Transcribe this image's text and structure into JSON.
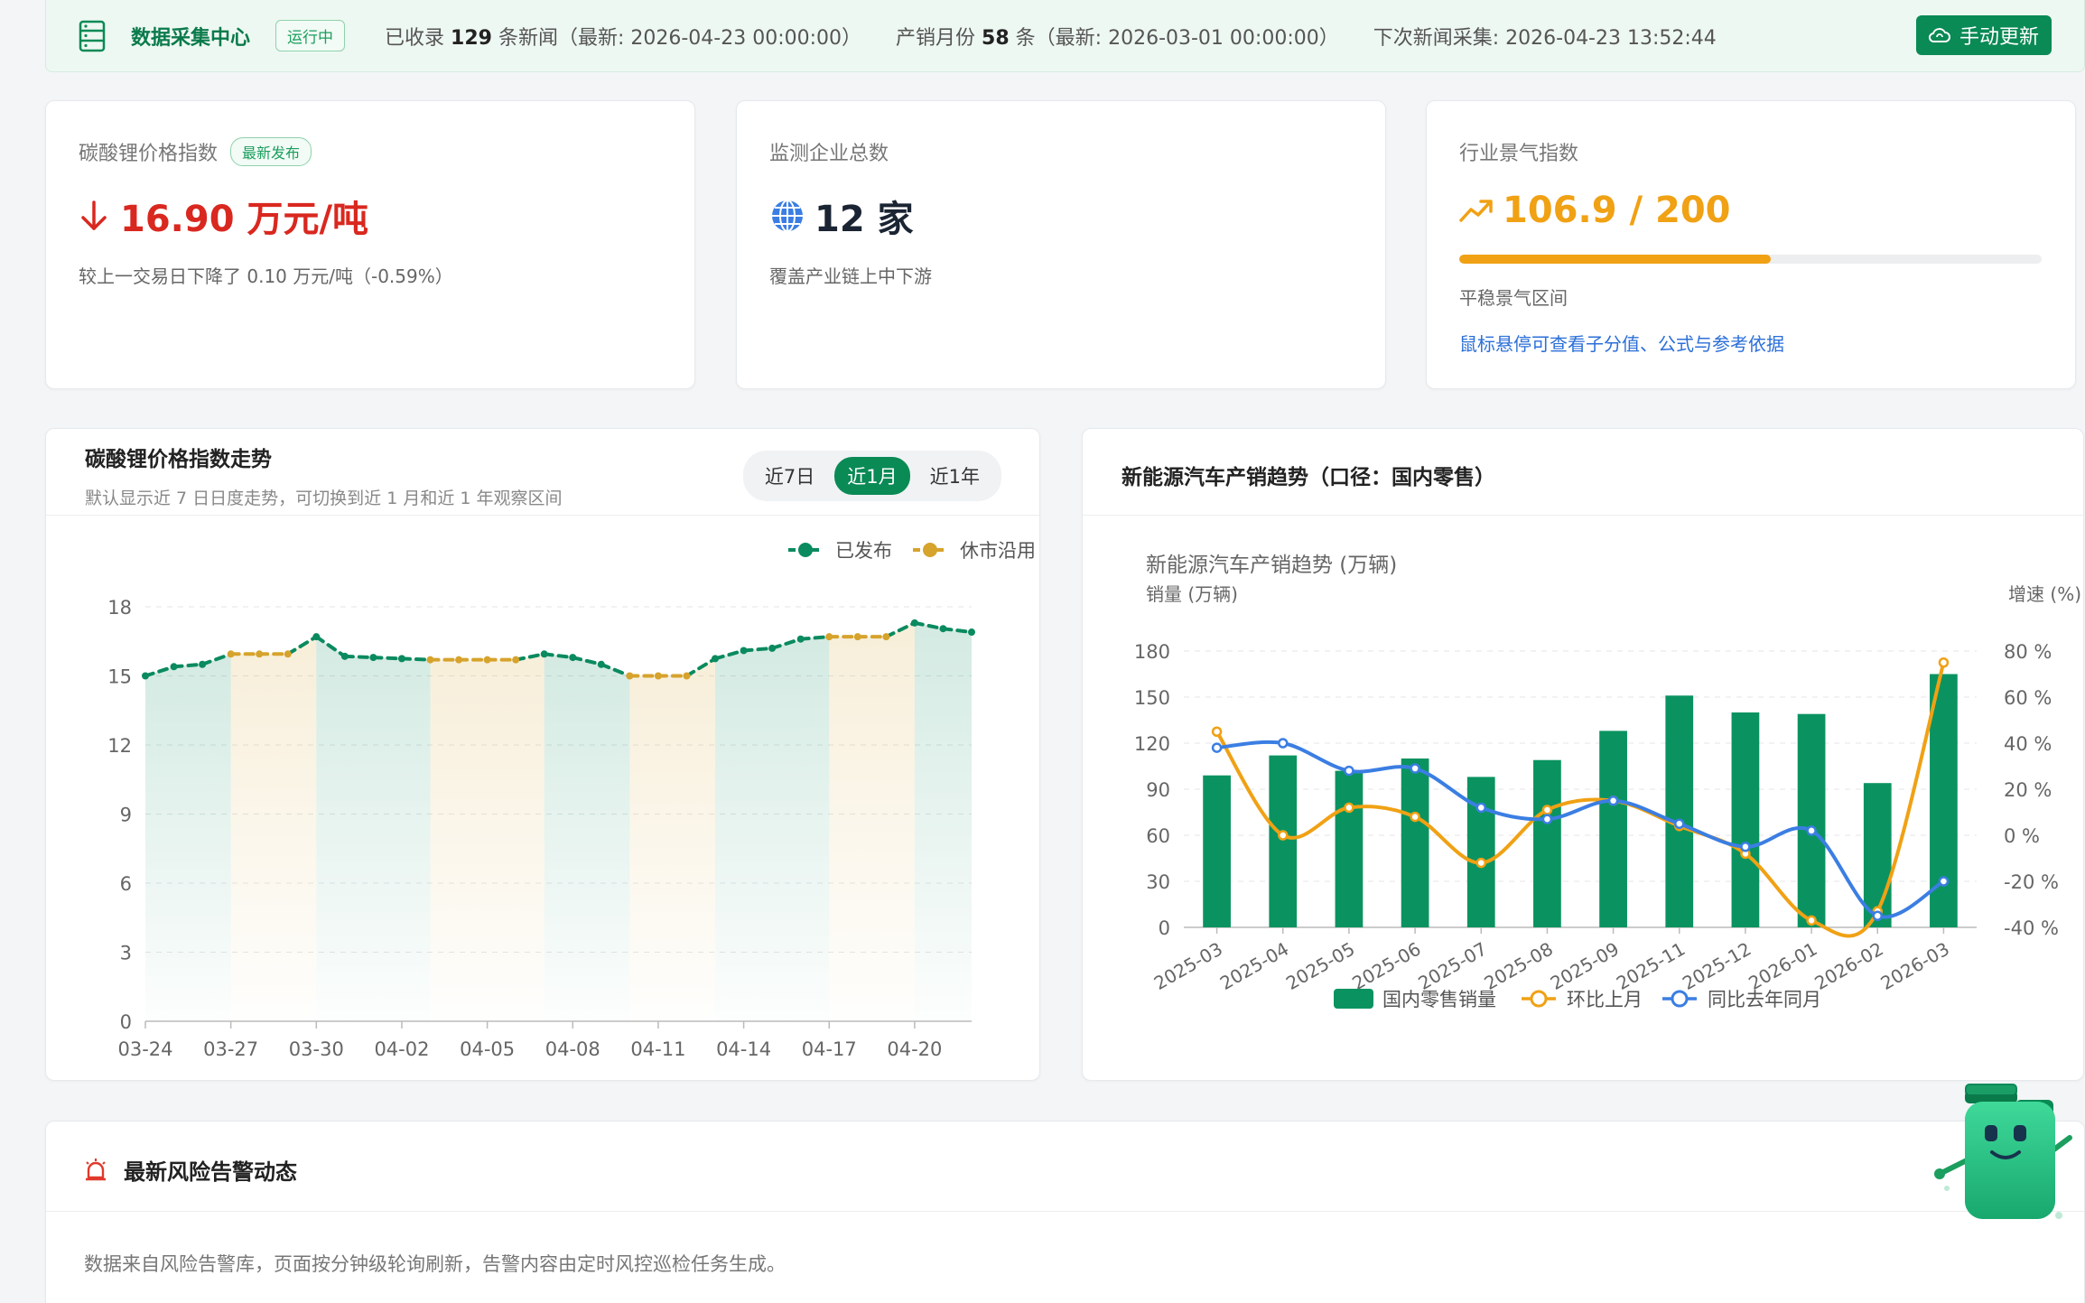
{
  "topbar": {
    "title": "数据采集中心",
    "status": "运行中",
    "news_prefix": "已收录",
    "news_count": "129",
    "news_suffix": "条新闻（最新: 2026-04-23 00:00:00）",
    "prod_prefix": "产销月份",
    "prod_count": "58",
    "prod_suffix": "条（最新: 2026-03-01 00:00:00）",
    "next_collect": "下次新闻采集: 2026-04-23 13:52:44",
    "refresh_label": "手动更新"
  },
  "kpi": {
    "price": {
      "label": "碳酸锂价格指数",
      "badge": "最新发布",
      "value": "16.90 万元/吨",
      "sub": "较上一交易日下降了 0.10 万元/吨（-0.59%）",
      "color": "#d9281f"
    },
    "companies": {
      "label": "监测企业总数",
      "value": "12 家",
      "sub": "覆盖产业链上中下游"
    },
    "sentiment": {
      "label": "行业景气指数",
      "value": "106.9 / 200",
      "score": 106.9,
      "max": 200,
      "zone": "平稳景气区间",
      "hint": "鼠标悬停可查看子分值、公式与参考依据",
      "color": "#f0a114"
    }
  },
  "price_panel": {
    "title": "碳酸锂价格指数走势",
    "subtitle": "默认显示近 7 日日度走势，可切换到近 1 月和近 1 年观察区间",
    "tabs": [
      "近7日",
      "近1月",
      "近1年"
    ],
    "active_tab": 1
  },
  "ev_panel": {
    "title": "新能源汽车产销趋势（口径：国内零售）"
  },
  "risk_panel": {
    "title": "最新风险告警动态",
    "note": "数据来自风险告警库，页面按分钟级轮询刷新，告警内容由定时风控巡检任务生成。"
  },
  "chart_data": [
    {
      "type": "line",
      "legend": [
        "已发布",
        "休市沿用"
      ],
      "legend_position": "top-right",
      "x": [
        "03-24",
        "03-25",
        "03-26",
        "03-27",
        "03-28",
        "03-29",
        "03-30",
        "03-31",
        "04-01",
        "04-02",
        "04-03",
        "04-04",
        "04-05",
        "04-06",
        "04-07",
        "04-08",
        "04-09",
        "04-10",
        "04-11",
        "04-12",
        "04-13",
        "04-14",
        "04-15",
        "04-16",
        "04-17",
        "04-18",
        "04-19",
        "04-20",
        "04-21",
        "04-22"
      ],
      "x_tick_labels": [
        "03-24",
        "03-27",
        "03-30",
        "04-02",
        "04-05",
        "04-08",
        "04-11",
        "04-14",
        "04-17",
        "04-20"
      ],
      "values": [
        15.0,
        15.4,
        15.5,
        15.95,
        15.95,
        15.95,
        16.7,
        15.85,
        15.8,
        15.75,
        15.7,
        15.7,
        15.7,
        15.7,
        15.95,
        15.8,
        15.5,
        15.0,
        15.0,
        15.0,
        15.75,
        16.1,
        16.2,
        16.6,
        16.7,
        16.7,
        16.7,
        17.3,
        17.05,
        16.9
      ],
      "status": [
        "已发布",
        "已发布",
        "已发布",
        "休市沿用",
        "休市沿用",
        "休市沿用",
        "已发布",
        "已发布",
        "已发布",
        "已发布",
        "休市沿用",
        "休市沿用",
        "休市沿用",
        "休市沿用",
        "已发布",
        "已发布",
        "已发布",
        "休市沿用",
        "休市沿用",
        "休市沿用",
        "已发布",
        "已发布",
        "已发布",
        "已发布",
        "休市沿用",
        "休市沿用",
        "休市沿用",
        "已发布",
        "已发布",
        "已发布"
      ],
      "ylim": [
        0,
        18
      ],
      "yticks": [
        0,
        3,
        6,
        9,
        12,
        15,
        18
      ],
      "grid": true,
      "colors": {
        "published": "#0a8a5f",
        "holiday": "#d6a32c"
      }
    },
    {
      "type": "bar",
      "title": "新能源汽车产销趋势 (万辆)",
      "ylabel_left": "销量 (万辆)",
      "ylabel_right": "增速 (%)",
      "categories": [
        "2025-03",
        "2025-04",
        "2025-05",
        "2025-06",
        "2025-07",
        "2025-08",
        "2025-09",
        "2025-11",
        "2025-12",
        "2026-01",
        "2026-02",
        "2026-03"
      ],
      "series": [
        {
          "name": "国内零售销量",
          "type": "bar",
          "values": [
            99,
            112,
            102,
            110,
            98,
            109,
            128,
            151,
            140,
            139,
            94,
            165
          ],
          "color": "#0a9360"
        },
        {
          "name": "环比上月",
          "type": "line",
          "axis": "right",
          "values": [
            45,
            0,
            12,
            8,
            -12,
            11,
            15,
            4,
            -8,
            -37,
            -33,
            75
          ],
          "color": "#f0a114"
        },
        {
          "name": "同比去年同月",
          "type": "line",
          "axis": "right",
          "values": [
            38,
            40,
            28,
            29,
            12,
            7,
            15,
            5,
            -5,
            2,
            -35,
            -20
          ],
          "color": "#3b7ee3"
        }
      ],
      "ylim_left": [
        0,
        180
      ],
      "yticks_left": [
        0,
        30,
        60,
        90,
        120,
        150,
        180
      ],
      "ylim_right": [
        -40,
        80
      ],
      "yticks_right": [
        "-40 %",
        "-20 %",
        "0 %",
        "20 %",
        "40 %",
        "60 %",
        "80 %"
      ],
      "legend_position": "bottom",
      "grid": true
    }
  ]
}
